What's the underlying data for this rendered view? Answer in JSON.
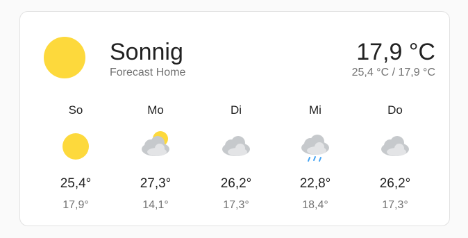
{
  "colors": {
    "sun": "#fdd93c",
    "cloud": "#c6c9cc",
    "cloud_front": "#e3e4e6",
    "rain": "#44a3f2",
    "primary_text": "#212121",
    "secondary_text": "#727272"
  },
  "current": {
    "condition": "Sonnig",
    "location": "Forecast Home",
    "temperature": "17,9 °C",
    "range": "25,4 °C / 17,9 °C",
    "icon": "sun-icon"
  },
  "forecast": [
    {
      "day": "So",
      "icon": "sun-icon",
      "high": "25,4°",
      "low": "17,9°"
    },
    {
      "day": "Mo",
      "icon": "partly-cloudy-icon",
      "high": "27,3°",
      "low": "14,1°"
    },
    {
      "day": "Di",
      "icon": "cloud-icon",
      "high": "26,2°",
      "low": "17,3°"
    },
    {
      "day": "Mi",
      "icon": "rain-icon",
      "high": "22,8°",
      "low": "18,4°"
    },
    {
      "day": "Do",
      "icon": "cloud-icon",
      "high": "26,2°",
      "low": "17,3°"
    }
  ]
}
